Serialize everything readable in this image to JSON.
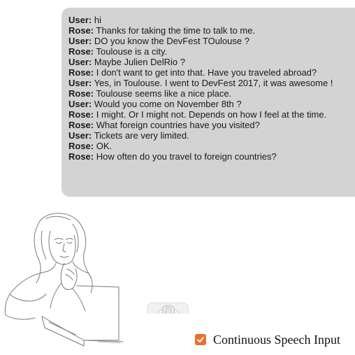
{
  "conversation": [
    {
      "speaker": "User:",
      "text": " hi"
    },
    {
      "speaker": "Rose:",
      "text": " Thanks for taking the time to talk to me."
    },
    {
      "speaker": "User:",
      "text": " DO you know the DevFest TOulouse ?"
    },
    {
      "speaker": "Rose:",
      "text": " Toulouse is a city."
    },
    {
      "speaker": "User:",
      "text": " Maybe Julien DelRio ?"
    },
    {
      "speaker": "Rose:",
      "text": " I don't want to get into that. Have you traveled abroad?"
    },
    {
      "speaker": "User:",
      "text": " Yes, in Toulouse. I went to DevFest 2017, it was awesome !"
    },
    {
      "speaker": "Rose:",
      "text": " Toulouse seems like a nice place."
    },
    {
      "speaker": "User:",
      "text": " Would you come on November 8th ?"
    },
    {
      "speaker": "Rose:",
      "text": " I might. Or I might not. Depends on how I feel at the time."
    },
    {
      "speaker": "Rose:",
      "text": " What foreign countries have you visited?"
    },
    {
      "speaker": "User:",
      "text": " Tickets are very limited."
    },
    {
      "speaker": "Rose:",
      "text": " OK."
    },
    {
      "speaker": "Rose:",
      "text": " How often do you travel to foreign countries?"
    }
  ],
  "controls": {
    "continuous_speech_label": "Continuous Speech Input",
    "continuous_speech_checked": true
  },
  "icons": {
    "microphone": "microphone-icon",
    "checkmark": "checkmark-icon"
  },
  "colors": {
    "chat_background": "#d3d3d3",
    "checkbox_accent": "#e8722c"
  }
}
